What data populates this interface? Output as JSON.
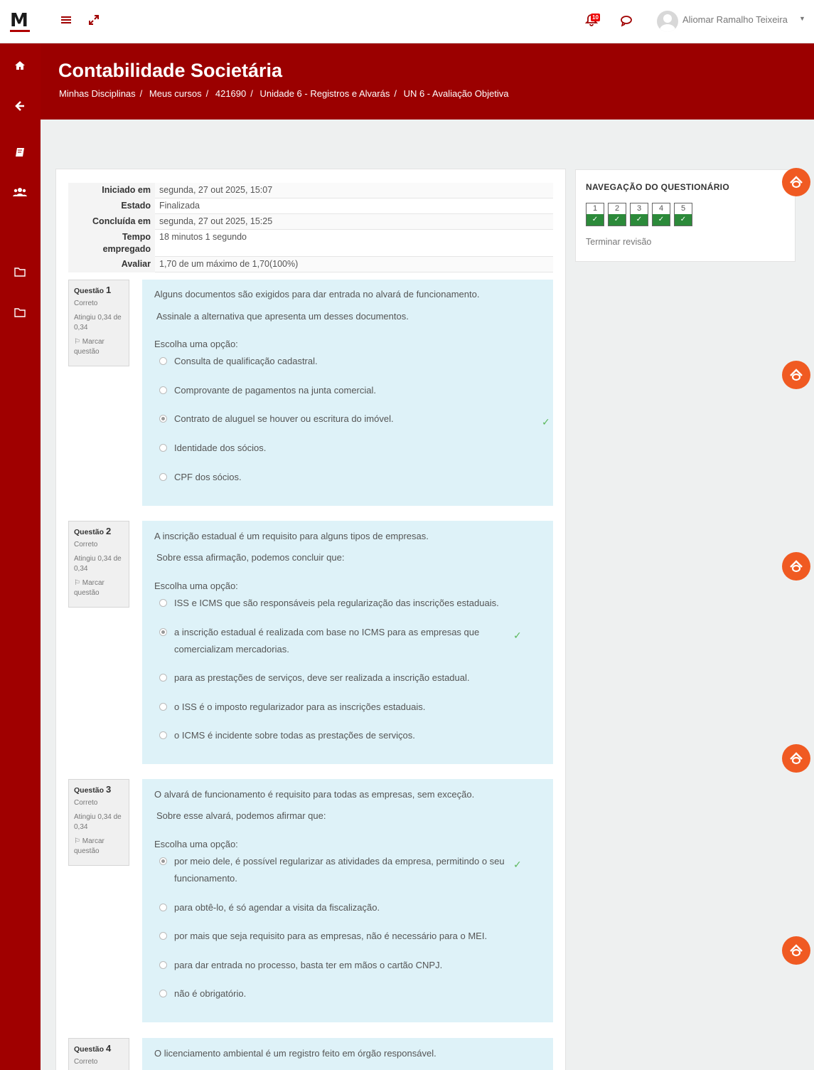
{
  "navbar": {
    "logo": "M",
    "notification_count": "10",
    "user_name": "Aliomar Ramalho Teixeira"
  },
  "header": {
    "title": "Contabilidade Societária",
    "breadcrumb": [
      "Minhas Disciplinas",
      "Meus cursos",
      "421690",
      "Unidade 6 - Registros e Alvarás",
      "UN 6 - Avaliação Objetiva"
    ]
  },
  "summary": {
    "rows": [
      {
        "label": "Iniciado em",
        "value": "segunda, 27 out 2025, 15:07"
      },
      {
        "label": "Estado",
        "value": "Finalizada"
      },
      {
        "label": "Concluída em",
        "value": "segunda, 27 out 2025, 15:25"
      },
      {
        "label": "Tempo empregado",
        "value": "18 minutos 1 segundo"
      },
      {
        "label": "Avaliar",
        "value": "1,70 de um máximo de 1,70(100%)"
      }
    ]
  },
  "questions": [
    {
      "number_prefix": "Questão",
      "number": "1",
      "state": "Correto",
      "grade": "Atingiu 0,34 de 0,34",
      "flag": "Marcar questão",
      "text": "Alguns documentos são exigidos para dar entrada no alvará de funcionamento.",
      "sub": "Assinale a alternativa que apresenta um desses documentos.",
      "prompt": "Escolha uma opção:",
      "options": [
        "Consulta de qualificação cadastral.",
        "Comprovante de pagamentos na junta comercial.",
        "Contrato de aluguel se houver ou escritura do imóvel.",
        "Identidade dos sócios.",
        "CPF dos sócios."
      ],
      "selected": 2
    },
    {
      "number_prefix": "Questão",
      "number": "2",
      "state": "Correto",
      "grade": "Atingiu 0,34 de 0,34",
      "flag": "Marcar questão",
      "text": "A inscrição estadual é um requisito para alguns tipos de empresas.",
      "sub": "Sobre essa afirmação, podemos concluir que:",
      "prompt": "Escolha uma opção:",
      "options": [
        "ISS e ICMS que são responsáveis pela regularização das inscrições estaduais.",
        "a inscrição estadual é realizada com base no ICMS para as empresas que comercializam mercadorias.",
        "para as prestações de serviços, deve ser realizada a inscrição estadual.",
        "o ISS é o imposto regularizador para as inscrições estaduais.",
        "o ICMS é incidente sobre todas as prestações de serviços."
      ],
      "selected": 1
    },
    {
      "number_prefix": "Questão",
      "number": "3",
      "state": "Correto",
      "grade": "Atingiu 0,34 de 0,34",
      "flag": "Marcar questão",
      "text": "O alvará de funcionamento é requisito para todas as empresas, sem exceção.",
      "sub": "Sobre esse alvará, podemos afirmar que:",
      "prompt": "Escolha uma opção:",
      "options": [
        "por meio dele, é possível regularizar as atividades da empresa, permitindo o seu funcionamento.",
        "para obtê-lo, é só agendar a visita da fiscalização.",
        "por mais que seja requisito para as empresas, não é necessário para o MEI.",
        "para dar entrada no processo, basta ter em mãos o cartão CNPJ.",
        "não é obrigatório."
      ],
      "selected": 0
    },
    {
      "number_prefix": "Questão",
      "number": "4",
      "state": "Correto",
      "text": "O licenciamento ambiental é um registro feito em órgão responsável."
    }
  ],
  "quiz_nav": {
    "title": "NAVEGAÇÃO DO QUESTIONÁRIO",
    "buttons": [
      "1",
      "2",
      "3",
      "4",
      "5"
    ],
    "finish_label": "Terminar revisão"
  },
  "colors": {
    "brand": "#a00000",
    "header": "#9b0000",
    "answer_bg": "#def2f8",
    "correct": "#2c8a3a",
    "fab": "#f05a22"
  }
}
